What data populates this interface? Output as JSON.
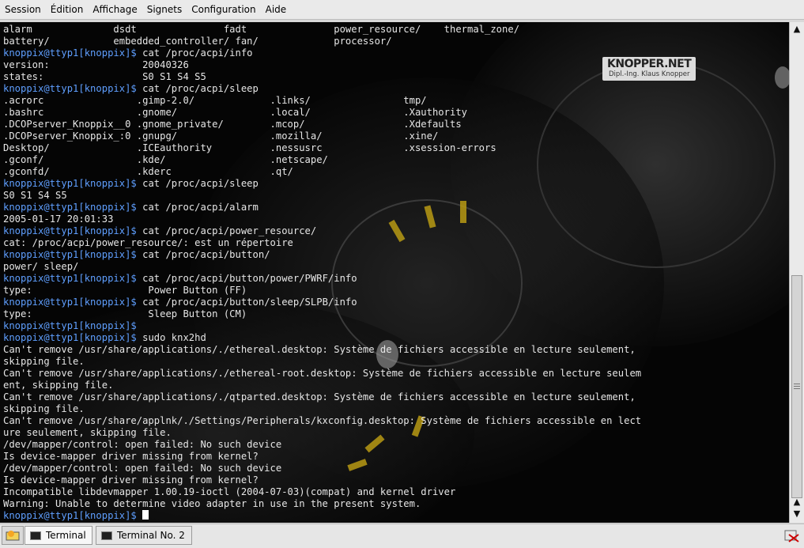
{
  "menubar": {
    "items": [
      "Session",
      "Édition",
      "Affichage",
      "Signets",
      "Configuration",
      "Aide"
    ]
  },
  "terminal": {
    "logo": {
      "main": "KNOPPER.NET",
      "sub": "Dipl.-Ing. Klaus Knopper"
    },
    "lines": [
      [
        {
          "t": "alarm              dsdt               fadt               power_resource/    thermal_zone/"
        }
      ],
      [
        {
          "t": "battery/           embedded_controller/ fan/             processor/"
        }
      ],
      [
        {
          "t": "knoppix@ttyp1[knoppix]$ ",
          "p": 1
        },
        {
          "t": "cat /proc/acpi/info"
        }
      ],
      [
        {
          "t": "version:                20040326"
        }
      ],
      [
        {
          "t": "states:                 S0 S1 S4 S5"
        }
      ],
      [
        {
          "t": "knoppix@ttyp1[knoppix]$ ",
          "p": 1
        },
        {
          "t": "cat /proc/acpi/sleep"
        }
      ],
      [
        {
          "t": ".acrorc                .gimp-2.0/             .links/                tmp/"
        }
      ],
      [
        {
          "t": ".bashrc                .gnome/                .local/                .Xauthority"
        }
      ],
      [
        {
          "t": ".DCOPserver_Knoppix__0 .gnome_private/        .mcop/                 .Xdefaults"
        }
      ],
      [
        {
          "t": ".DCOPserver_Knoppix_:0 .gnupg/                .mozilla/              .xine/"
        }
      ],
      [
        {
          "t": "Desktop/               .ICEauthority          .nessusrc              .xsession-errors"
        }
      ],
      [
        {
          "t": ".gconf/                .kde/                  .netscape/"
        }
      ],
      [
        {
          "t": ".gconfd/               .kderc                 .qt/"
        }
      ],
      [
        {
          "t": "knoppix@ttyp1[knoppix]$ ",
          "p": 1
        },
        {
          "t": "cat /proc/acpi/sleep"
        }
      ],
      [
        {
          "t": "S0 S1 S4 S5"
        }
      ],
      [
        {
          "t": "knoppix@ttyp1[knoppix]$ ",
          "p": 1
        },
        {
          "t": "cat /proc/acpi/alarm"
        }
      ],
      [
        {
          "t": "2005-01-17 20:01:33"
        }
      ],
      [
        {
          "t": "knoppix@ttyp1[knoppix]$ ",
          "p": 1
        },
        {
          "t": "cat /proc/acpi/power_resource/"
        }
      ],
      [
        {
          "t": "cat: /proc/acpi/power_resource/: est un répertoire"
        }
      ],
      [
        {
          "t": "knoppix@ttyp1[knoppix]$ ",
          "p": 1
        },
        {
          "t": "cat /proc/acpi/button/"
        }
      ],
      [
        {
          "t": "power/ sleep/"
        }
      ],
      [
        {
          "t": "knoppix@ttyp1[knoppix]$ ",
          "p": 1
        },
        {
          "t": "cat /proc/acpi/button/power/PWRF/info"
        }
      ],
      [
        {
          "t": "type:                    Power Button (FF)"
        }
      ],
      [
        {
          "t": "knoppix@ttyp1[knoppix]$ ",
          "p": 1
        },
        {
          "t": "cat /proc/acpi/button/sleep/SLPB/info"
        }
      ],
      [
        {
          "t": "type:                    Sleep Button (CM)"
        }
      ],
      [
        {
          "t": "knoppix@ttyp1[knoppix]$",
          "p": 1
        }
      ],
      [
        {
          "t": "knoppix@ttyp1[knoppix]$ ",
          "p": 1
        },
        {
          "t": "sudo knx2hd"
        }
      ],
      [
        {
          "t": "Can't remove /usr/share/applications/./ethereal.desktop: Système de fichiers accessible en lecture seulement,"
        }
      ],
      [
        {
          "t": "skipping file."
        }
      ],
      [
        {
          "t": "Can't remove /usr/share/applications/./ethereal-root.desktop: Système de fichiers accessible en lecture seulem"
        }
      ],
      [
        {
          "t": "ent, skipping file."
        }
      ],
      [
        {
          "t": "Can't remove /usr/share/applications/./qtparted.desktop: Système de fichiers accessible en lecture seulement,"
        }
      ],
      [
        {
          "t": "skipping file."
        }
      ],
      [
        {
          "t": "Can't remove /usr/share/applnk/./Settings/Peripherals/kxconfig.desktop: Système de fichiers accessible en lect"
        }
      ],
      [
        {
          "t": "ure seulement, skipping file."
        }
      ],
      [
        {
          "t": "/dev/mapper/control: open failed: No such device"
        }
      ],
      [
        {
          "t": "Is device-mapper driver missing from kernel?"
        }
      ],
      [
        {
          "t": "/dev/mapper/control: open failed: No such device"
        }
      ],
      [
        {
          "t": "Is device-mapper driver missing from kernel?"
        }
      ],
      [
        {
          "t": "Incompatible libdevmapper 1.00.19-ioctl (2004-07-03)(compat) and kernel driver"
        }
      ],
      [
        {
          "t": "Warning: Unable to determine video adapter in use in the present system."
        }
      ],
      [
        {
          "t": "knoppix@ttyp1[knoppix]$ ",
          "p": 1
        }
      ]
    ]
  },
  "scrollbar": {
    "up_icon": "arrow-up-icon",
    "down_icon": "arrow-down-icon"
  },
  "taskbar": {
    "tabs": [
      {
        "label": "Terminal",
        "active": true
      },
      {
        "label": "Terminal No. 2",
        "active": false
      }
    ]
  },
  "colors": {
    "prompt": "#5f9fff",
    "text": "#e6e6e6",
    "background": "#000000"
  }
}
